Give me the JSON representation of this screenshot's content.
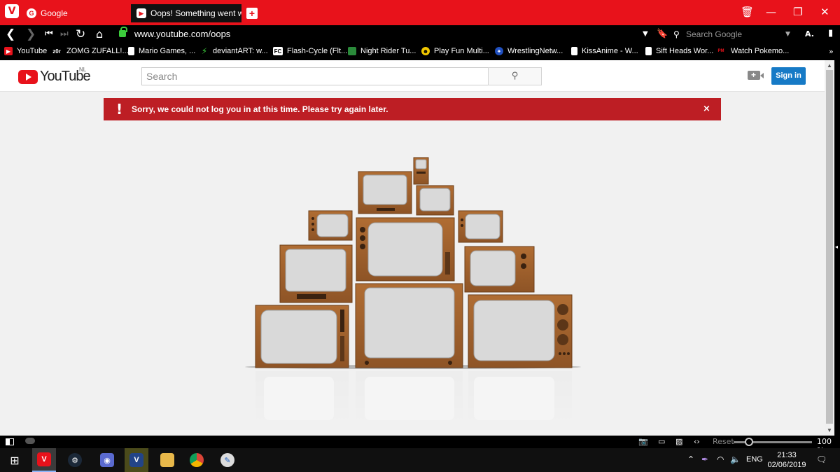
{
  "browser": {
    "tabs": [
      {
        "title": "Google",
        "favicon": "google-icon"
      },
      {
        "title": "Oops! Something went wro",
        "favicon": "youtube-icon"
      }
    ],
    "url": "www.youtube.com/oops",
    "search_placeholder": "Search Google",
    "profile_initial": "A.",
    "bookmarks": [
      {
        "label": "YouTube",
        "icon": "youtube-icon"
      },
      {
        "label": "ZOMG ZUFALL!...",
        "icon": "z0r-icon"
      },
      {
        "label": "Mario Games, ...",
        "icon": "page-icon"
      },
      {
        "label": "deviantART: w...",
        "icon": "deviantart-icon"
      },
      {
        "label": "Flash-Cycle (Flt...",
        "icon": "flashcycle-icon"
      },
      {
        "label": "Night Rider Tu...",
        "icon": "nightrider-icon"
      },
      {
        "label": "Play Fun Multi...",
        "icon": "smiley-icon"
      },
      {
        "label": "WrestlingNetw...",
        "icon": "wrestling-icon"
      },
      {
        "label": "KissAnime - W...",
        "icon": "page-icon"
      },
      {
        "label": "Sift Heads Wor...",
        "icon": "page-icon"
      },
      {
        "label": "Watch Pokemo...",
        "icon": "pokemon-icon"
      }
    ],
    "bookmark_icon_labels": {
      "z0r": "z0r",
      "fc": "FC",
      "pn": "PM"
    }
  },
  "youtube": {
    "logo_text": "YouTube",
    "region": "NL",
    "search_placeholder": "Search",
    "signin_label": "Sign in",
    "upload_plus": "+",
    "alert_message": "Sorry, we could not log you in at this time. Please try again later.",
    "alert_bang": "!",
    "alert_close": "×"
  },
  "statusbar": {
    "reset_label": "Reset",
    "zoom": "100 %",
    "zoom_fraction": 0.2
  },
  "taskbar": {
    "language": "ENG",
    "time": "21:33",
    "date": "02/06/2019"
  },
  "colors": {
    "vivaldi_red": "#e8121b",
    "youtube_red": "#e8121b",
    "alert_red": "#bd1e24",
    "signin_blue": "#167ac6",
    "tv_wood": "#a0612c",
    "tv_screen": "#d9d9d9"
  }
}
